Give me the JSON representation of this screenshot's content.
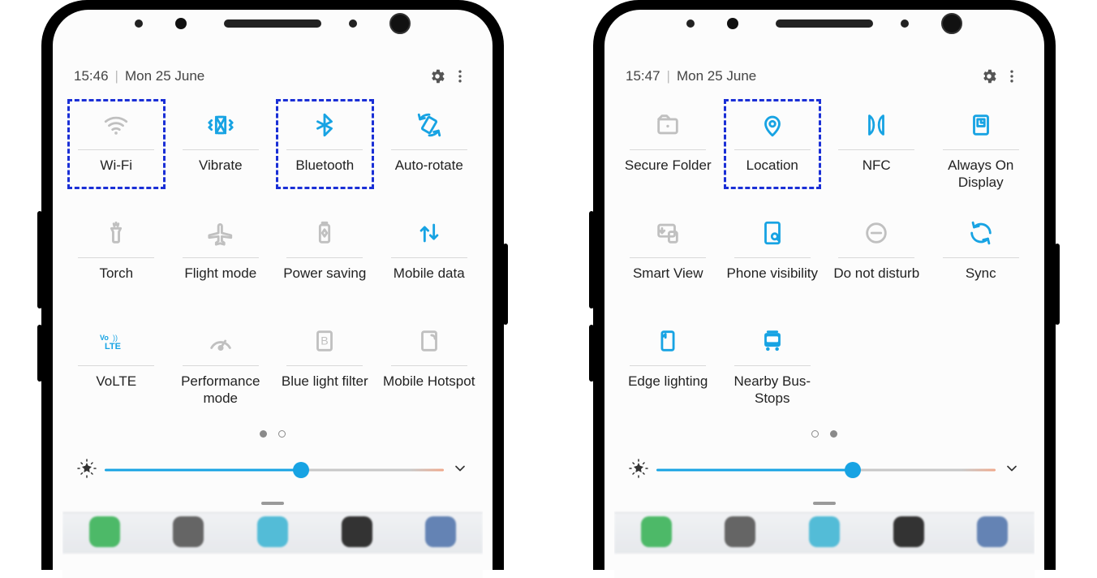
{
  "phones": [
    {
      "status": {
        "time": "15:46",
        "date": "Mon 25 June"
      },
      "pager": {
        "current": 0,
        "count": 2
      },
      "tiles": [
        {
          "key": "wifi",
          "label": "Wi-Fi",
          "active": false,
          "highlight": true,
          "icon": "wifi"
        },
        {
          "key": "vibrate",
          "label": "Vibrate",
          "active": true,
          "highlight": false,
          "icon": "vibrate"
        },
        {
          "key": "bluetooth",
          "label": "Bluetooth",
          "active": true,
          "highlight": true,
          "icon": "bluetooth"
        },
        {
          "key": "autorotate",
          "label": "Auto-rotate",
          "active": true,
          "highlight": false,
          "icon": "autorotate"
        },
        {
          "key": "torch",
          "label": "Torch",
          "active": false,
          "highlight": false,
          "icon": "torch"
        },
        {
          "key": "flight",
          "label": "Flight mode",
          "active": false,
          "highlight": false,
          "icon": "plane"
        },
        {
          "key": "power",
          "label": "Power saving",
          "active": false,
          "highlight": false,
          "icon": "battery"
        },
        {
          "key": "mdata",
          "label": "Mobile data",
          "active": true,
          "highlight": false,
          "icon": "updown"
        },
        {
          "key": "volte",
          "label": "VoLTE",
          "active": true,
          "highlight": false,
          "icon": "volte"
        },
        {
          "key": "perf",
          "label": "Performance mode",
          "active": false,
          "highlight": false,
          "icon": "gauge"
        },
        {
          "key": "bluelight",
          "label": "Blue light filter",
          "active": false,
          "highlight": false,
          "icon": "bluelight"
        },
        {
          "key": "hotspot",
          "label": "Mobile Hotspot",
          "active": false,
          "highlight": false,
          "icon": "hotspot"
        }
      ]
    },
    {
      "status": {
        "time": "15:47",
        "date": "Mon 25 June"
      },
      "pager": {
        "current": 1,
        "count": 2
      },
      "tiles": [
        {
          "key": "securefolder",
          "label": "Secure Folder",
          "active": false,
          "highlight": false,
          "icon": "securefolder"
        },
        {
          "key": "location",
          "label": "Location",
          "active": true,
          "highlight": true,
          "icon": "location"
        },
        {
          "key": "nfc",
          "label": "NFC",
          "active": true,
          "highlight": false,
          "icon": "nfc"
        },
        {
          "key": "aod",
          "label": "Always On Display",
          "active": true,
          "highlight": false,
          "icon": "aod"
        },
        {
          "key": "smartview",
          "label": "Smart View",
          "active": false,
          "highlight": false,
          "icon": "smartview"
        },
        {
          "key": "phonevis",
          "label": "Phone visibility",
          "active": true,
          "highlight": false,
          "icon": "phonevis"
        },
        {
          "key": "dnd",
          "label": "Do not disturb",
          "active": false,
          "highlight": false,
          "icon": "dnd"
        },
        {
          "key": "sync",
          "label": "Sync",
          "active": true,
          "highlight": false,
          "icon": "sync"
        },
        {
          "key": "edge",
          "label": "Edge lighting",
          "active": true,
          "highlight": false,
          "icon": "edge"
        },
        {
          "key": "bus",
          "label": "Nearby Bus-Stops",
          "active": true,
          "highlight": false,
          "icon": "bus"
        }
      ]
    }
  ],
  "brightness": {
    "percent": 58
  },
  "dock_colors": [
    "#2fae4f",
    "#4b4b4b",
    "#36b1d1",
    "#111111",
    "#4a6fa8"
  ]
}
